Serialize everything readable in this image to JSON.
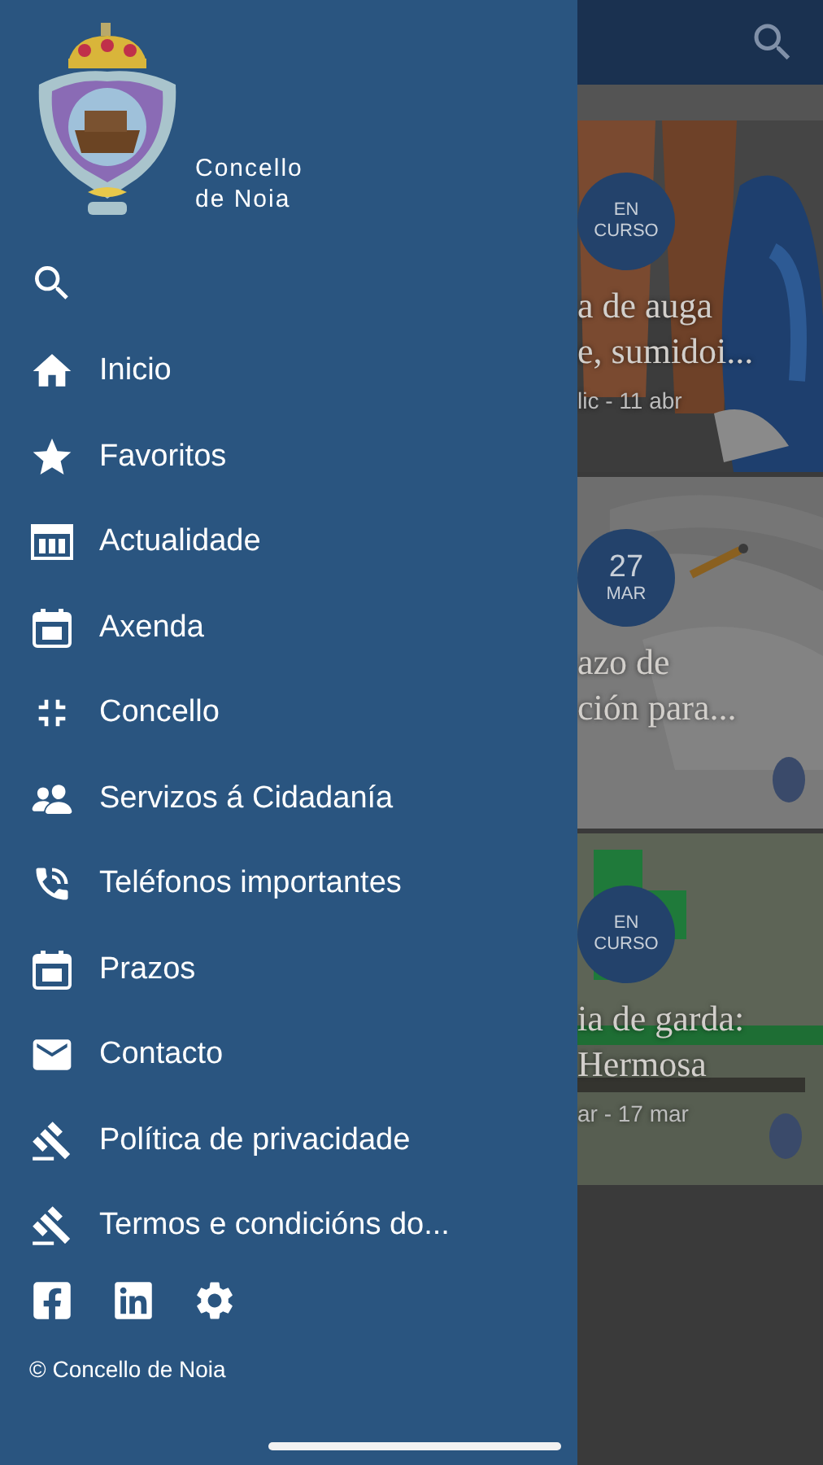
{
  "drawer": {
    "logo_text": [
      "Concello",
      "de Noia"
    ],
    "menu": [
      {
        "label": "Inicio"
      },
      {
        "label": "Favoritos"
      },
      {
        "label": "Actualidade"
      },
      {
        "label": "Axenda"
      },
      {
        "label": "Concello"
      },
      {
        "label": "Servizos á Cidadanía"
      },
      {
        "label": "Teléfonos importantes"
      },
      {
        "label": "Prazos"
      },
      {
        "label": "Contacto"
      },
      {
        "label": "Política de privacidade"
      },
      {
        "label": "Termos e condicións do..."
      }
    ],
    "copyright": "© Concello de Noia"
  },
  "background": {
    "cards": [
      {
        "badge": {
          "kind": "status",
          "lines": [
            "EN",
            "CURSO"
          ]
        },
        "title": [
          "a de auga",
          "e, sumidoi..."
        ],
        "date": "lic - 11 abr"
      },
      {
        "badge": {
          "kind": "date",
          "lines": [
            "27",
            "MAR"
          ]
        },
        "title": [
          "azo de",
          "ción para..."
        ]
      },
      {
        "badge": {
          "kind": "status",
          "lines": [
            "EN",
            "CURSO"
          ]
        },
        "title": [
          "ia de garda:",
          "Hermosa"
        ],
        "date": "ar - 17 mar"
      }
    ]
  }
}
